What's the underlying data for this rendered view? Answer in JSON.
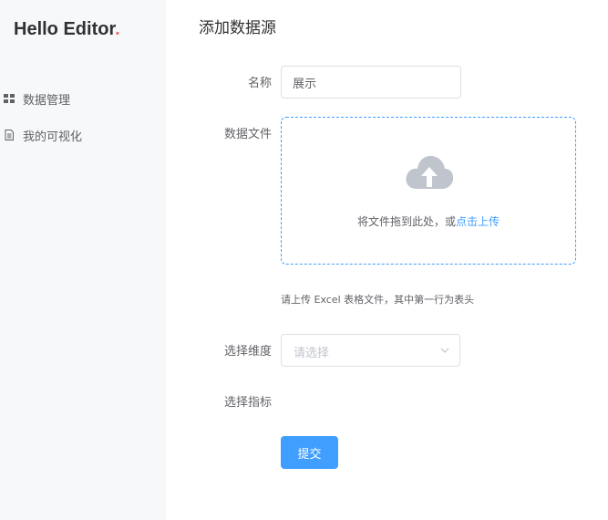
{
  "app": {
    "logo_text": "Hello Editor",
    "logo_dot": ".",
    "accent": "#409eff",
    "logo_dot_color": "#f56c6c"
  },
  "sidebar": {
    "items": [
      {
        "label": "数据管理",
        "icon": "grid-icon"
      },
      {
        "label": "我的可视化",
        "icon": "document-icon"
      }
    ]
  },
  "main": {
    "title": "添加数据源",
    "form": {
      "name_label": "名称",
      "name_value": "展示",
      "file_label": "数据文件",
      "upload_text": "将文件拖到此处，或",
      "upload_link": "点击上传",
      "upload_icon": "cloud-upload-icon",
      "tip": "请上传 Excel 表格文件，其中第一行为表头",
      "dimension_label": "选择维度",
      "dimension_placeholder": "请选择",
      "metric_label": "选择指标",
      "submit_label": "提交"
    }
  }
}
